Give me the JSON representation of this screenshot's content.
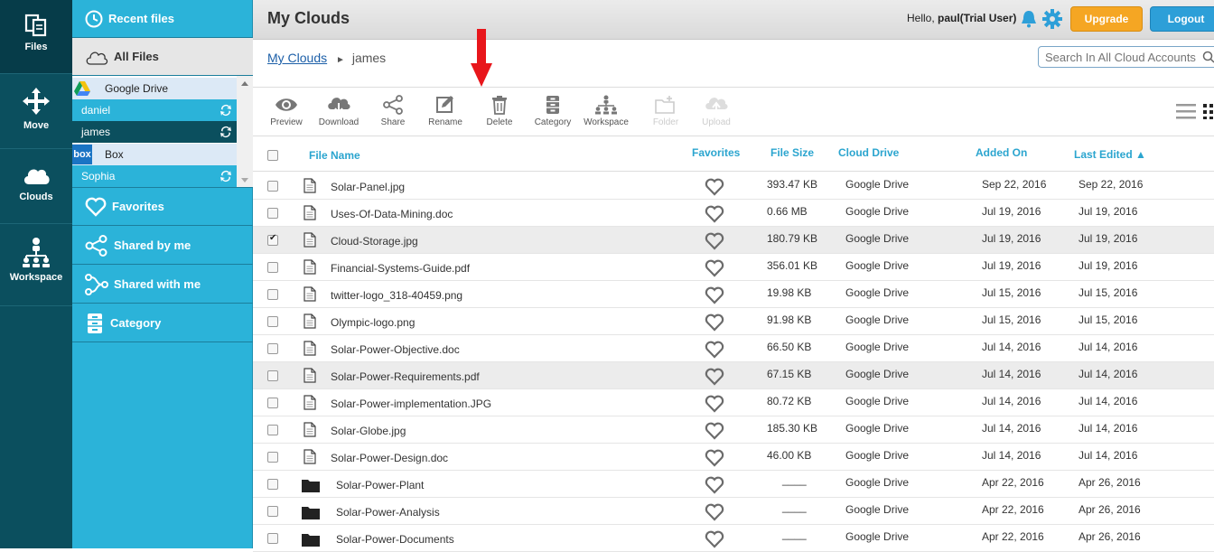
{
  "rail": [
    {
      "name": "files",
      "label": "Files"
    },
    {
      "name": "move",
      "label": "Move"
    },
    {
      "name": "clouds",
      "label": "Clouds"
    },
    {
      "name": "workspace",
      "label": "Workspace"
    }
  ],
  "panel": {
    "recent": "Recent files",
    "all_files": "All Files",
    "favorites": "Favorites",
    "shared_by_me": "Shared by me",
    "shared_with_me": "Shared with me",
    "category": "Category",
    "accounts": [
      {
        "name": "Google Drive",
        "folders": [
          "daniel",
          "james"
        ]
      },
      {
        "name": "Box",
        "folders": [
          "Sophia"
        ]
      }
    ],
    "box_logo_text": "box"
  },
  "header": {
    "title": "My Clouds",
    "greeting_prefix": "Hello, ",
    "user": "paul(Trial User)",
    "upgrade": "Upgrade",
    "logout": "Logout"
  },
  "breadcrumb": {
    "root": "My Clouds",
    "sep": "►",
    "current": "james"
  },
  "search": {
    "placeholder": "Search In All Cloud Accounts"
  },
  "toolbar": [
    {
      "id": "preview",
      "label": "Preview"
    },
    {
      "id": "download",
      "label": "Download"
    },
    {
      "id": "share",
      "label": "Share"
    },
    {
      "id": "rename",
      "label": "Rename"
    },
    {
      "id": "delete",
      "label": "Delete"
    },
    {
      "id": "category",
      "label": "Category"
    },
    {
      "id": "workspace",
      "label": "Workspace"
    },
    {
      "id": "folder",
      "label": "Folder"
    },
    {
      "id": "upload",
      "label": "Upload"
    }
  ],
  "columns": {
    "name": "File Name",
    "favorites": "Favorites",
    "size": "File Size",
    "drive": "Cloud Drive",
    "added": "Added On",
    "edited": "Last Edited ▲"
  },
  "files": [
    {
      "name": "Solar-Panel.jpg",
      "size": "393.47 KB",
      "drive": "Google Drive",
      "added": "Sep 22, 2016",
      "edited": "Sep 22, 2016",
      "type": "file"
    },
    {
      "name": "Uses-Of-Data-Mining.doc",
      "size": "0.66 MB",
      "drive": "Google Drive",
      "added": "Jul 19, 2016",
      "edited": "Jul 19, 2016",
      "type": "file"
    },
    {
      "name": "Cloud-Storage.jpg",
      "size": "180.79 KB",
      "drive": "Google Drive",
      "added": "Jul 19, 2016",
      "edited": "Jul 19, 2016",
      "type": "file",
      "checked": true
    },
    {
      "name": "Financial-Systems-Guide.pdf",
      "size": "356.01 KB",
      "drive": "Google Drive",
      "added": "Jul 19, 2016",
      "edited": "Jul 19, 2016",
      "type": "file"
    },
    {
      "name": "twitter-logo_318-40459.png",
      "size": "19.98 KB",
      "drive": "Google Drive",
      "added": "Jul 15, 2016",
      "edited": "Jul 15, 2016",
      "type": "file"
    },
    {
      "name": "Olympic-logo.png",
      "size": "91.98 KB",
      "drive": "Google Drive",
      "added": "Jul 15, 2016",
      "edited": "Jul 15, 2016",
      "type": "file"
    },
    {
      "name": "Solar-Power-Objective.doc",
      "size": "66.50 KB",
      "drive": "Google Drive",
      "added": "Jul 14, 2016",
      "edited": "Jul 14, 2016",
      "type": "file"
    },
    {
      "name": "Solar-Power-Requirements.pdf",
      "size": "67.15 KB",
      "drive": "Google Drive",
      "added": "Jul 14, 2016",
      "edited": "Jul 14, 2016",
      "type": "file",
      "hover": true
    },
    {
      "name": "Solar-Power-implementation.JPG",
      "size": "80.72 KB",
      "drive": "Google Drive",
      "added": "Jul 14, 2016",
      "edited": "Jul 14, 2016",
      "type": "file"
    },
    {
      "name": "Solar-Globe.jpg",
      "size": "185.30 KB",
      "drive": "Google Drive",
      "added": "Jul 14, 2016",
      "edited": "Jul 14, 2016",
      "type": "file"
    },
    {
      "name": "Solar-Power-Design.doc",
      "size": "46.00 KB",
      "drive": "Google Drive",
      "added": "Jul 14, 2016",
      "edited": "Jul 14, 2016",
      "type": "file"
    },
    {
      "name": "Solar-Power-Plant",
      "size": "____",
      "drive": "Google Drive",
      "added": "Apr 22, 2016",
      "edited": "Apr 26, 2016",
      "type": "folder"
    },
    {
      "name": "Solar-Power-Analysis",
      "size": "____",
      "drive": "Google Drive",
      "added": "Apr 22, 2016",
      "edited": "Apr 26, 2016",
      "type": "folder"
    },
    {
      "name": "Solar-Power-Documents",
      "size": "____",
      "drive": "Google Drive",
      "added": "Apr 22, 2016",
      "edited": "Apr 26, 2016",
      "type": "folder"
    }
  ],
  "colors": {
    "accent": "#2bb3d9",
    "rail": "#0b4f5e",
    "upgrade": "#f5a623",
    "logout": "#2d9fd8",
    "arrow": "#e8161b"
  }
}
